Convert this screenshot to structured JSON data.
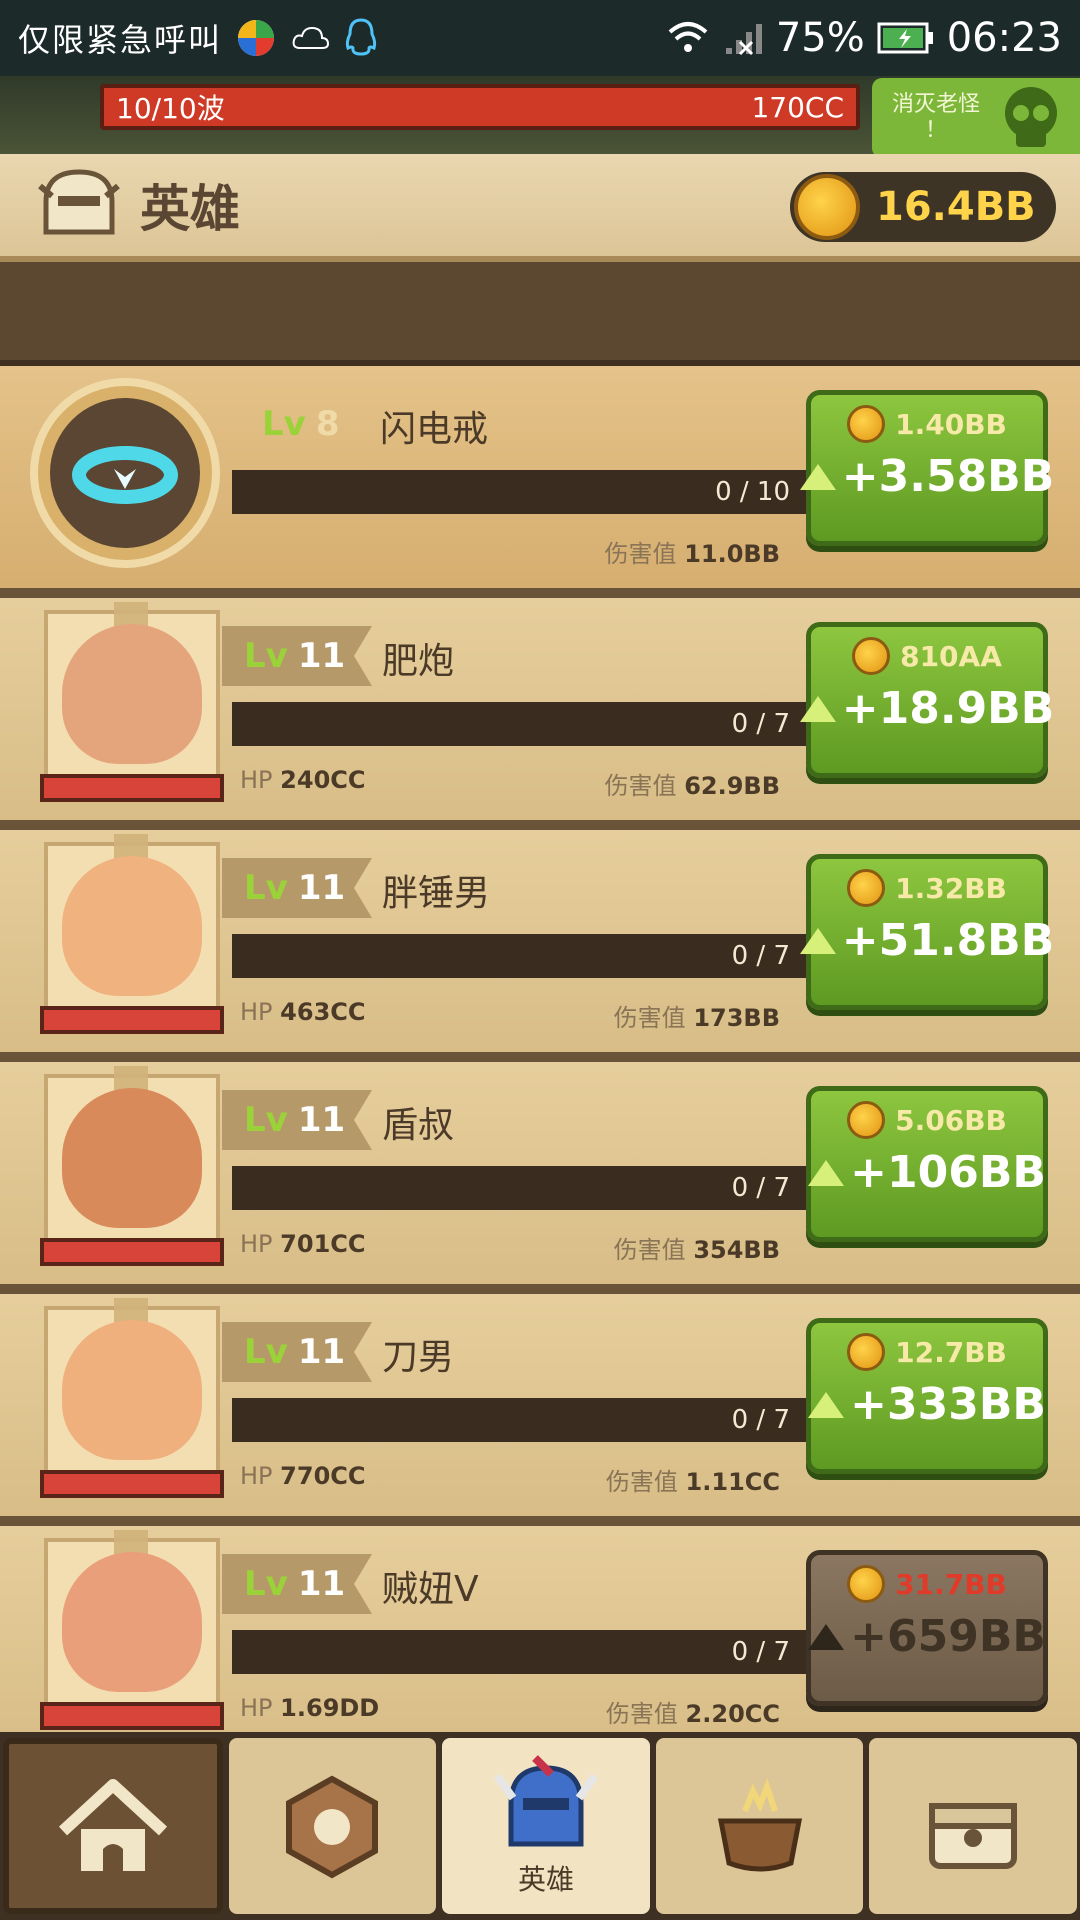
{
  "status_bar": {
    "left_text": "仅限紧急呼叫",
    "battery": "75%",
    "time": "06:23",
    "icons": [
      "app-icon",
      "weather-icon",
      "qq-icon",
      "wifi-icon",
      "signal-icon",
      "battery-icon"
    ]
  },
  "wave": {
    "label": "10/10波",
    "enemy_hp": "170CC",
    "boss_button": "消灭老怪\n！"
  },
  "header": {
    "title": "英雄",
    "gold": "16.4BB"
  },
  "heroes": [
    {
      "level_prefix": "Lv",
      "level": "8",
      "name": "闪电戒",
      "xp": "0 / 10",
      "hp_label": "",
      "hp": "",
      "dmg_label": "伤害值",
      "dmg": "11.0BB",
      "cost": "1.40BB",
      "gain": "+3.58BB",
      "disabled": false
    },
    {
      "level_prefix": "Lv",
      "level": "11",
      "name": "肥炮",
      "xp": "0 / 7",
      "hp_label": "HP",
      "hp": "240CC",
      "dmg_label": "伤害值",
      "dmg": "62.9BB",
      "cost": "810AA",
      "gain": "+18.9BB",
      "disabled": false
    },
    {
      "level_prefix": "Lv",
      "level": "11",
      "name": "胖锤男",
      "xp": "0 / 7",
      "hp_label": "HP",
      "hp": "463CC",
      "dmg_label": "伤害值",
      "dmg": "173BB",
      "cost": "1.32BB",
      "gain": "+51.8BB",
      "disabled": false
    },
    {
      "level_prefix": "Lv",
      "level": "11",
      "name": "盾叔",
      "xp": "0 / 7",
      "hp_label": "HP",
      "hp": "701CC",
      "dmg_label": "伤害值",
      "dmg": "354BB",
      "cost": "5.06BB",
      "gain": "+106BB",
      "disabled": false
    },
    {
      "level_prefix": "Lv",
      "level": "11",
      "name": "刀男",
      "xp": "0 / 7",
      "hp_label": "HP",
      "hp": "770CC",
      "dmg_label": "伤害值",
      "dmg": "1.11CC",
      "cost": "12.7BB",
      "gain": "+333BB",
      "disabled": false
    },
    {
      "level_prefix": "Lv",
      "level": "11",
      "name": "贼妞V",
      "xp": "0 / 7",
      "hp_label": "HP",
      "hp": "1.69DD",
      "dmg_label": "伤害值",
      "dmg": "2.20CC",
      "cost": "31.7BB",
      "gain": "+659BB",
      "disabled": true
    }
  ],
  "nav": {
    "items": [
      "home-icon",
      "rune-icon",
      "hero-helmet-icon",
      "cauldron-icon",
      "chest-icon"
    ],
    "active_label": "英雄"
  },
  "colors": {
    "accent_green": "#8dc63f",
    "gold": "#ffd34a",
    "danger_red": "#cf3a26"
  }
}
